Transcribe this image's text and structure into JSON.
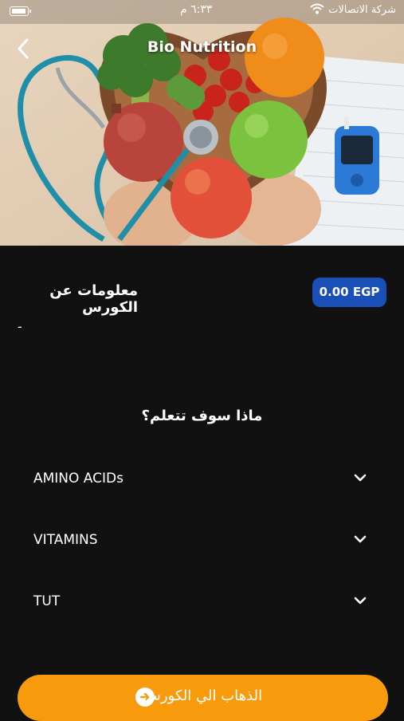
{
  "status_bar": {
    "time": "٦:٣٣ م",
    "carrier": "شركة الاتصالات"
  },
  "header": {
    "title": "Bio Nutrition"
  },
  "course": {
    "info_title": "معلومات عن الكورس",
    "price": "0.00 EGP",
    "description": "-"
  },
  "learn": {
    "heading": "ماذا سوف تتعلم؟",
    "topics": [
      "AMINO ACIDs",
      "VITAMINS",
      "TUT"
    ]
  },
  "cta": {
    "label": "الذهاب الي الكورس"
  },
  "colors": {
    "accent_orange": "#f79b0c",
    "price_blue": "#1a4fb8",
    "background": "#111112"
  }
}
